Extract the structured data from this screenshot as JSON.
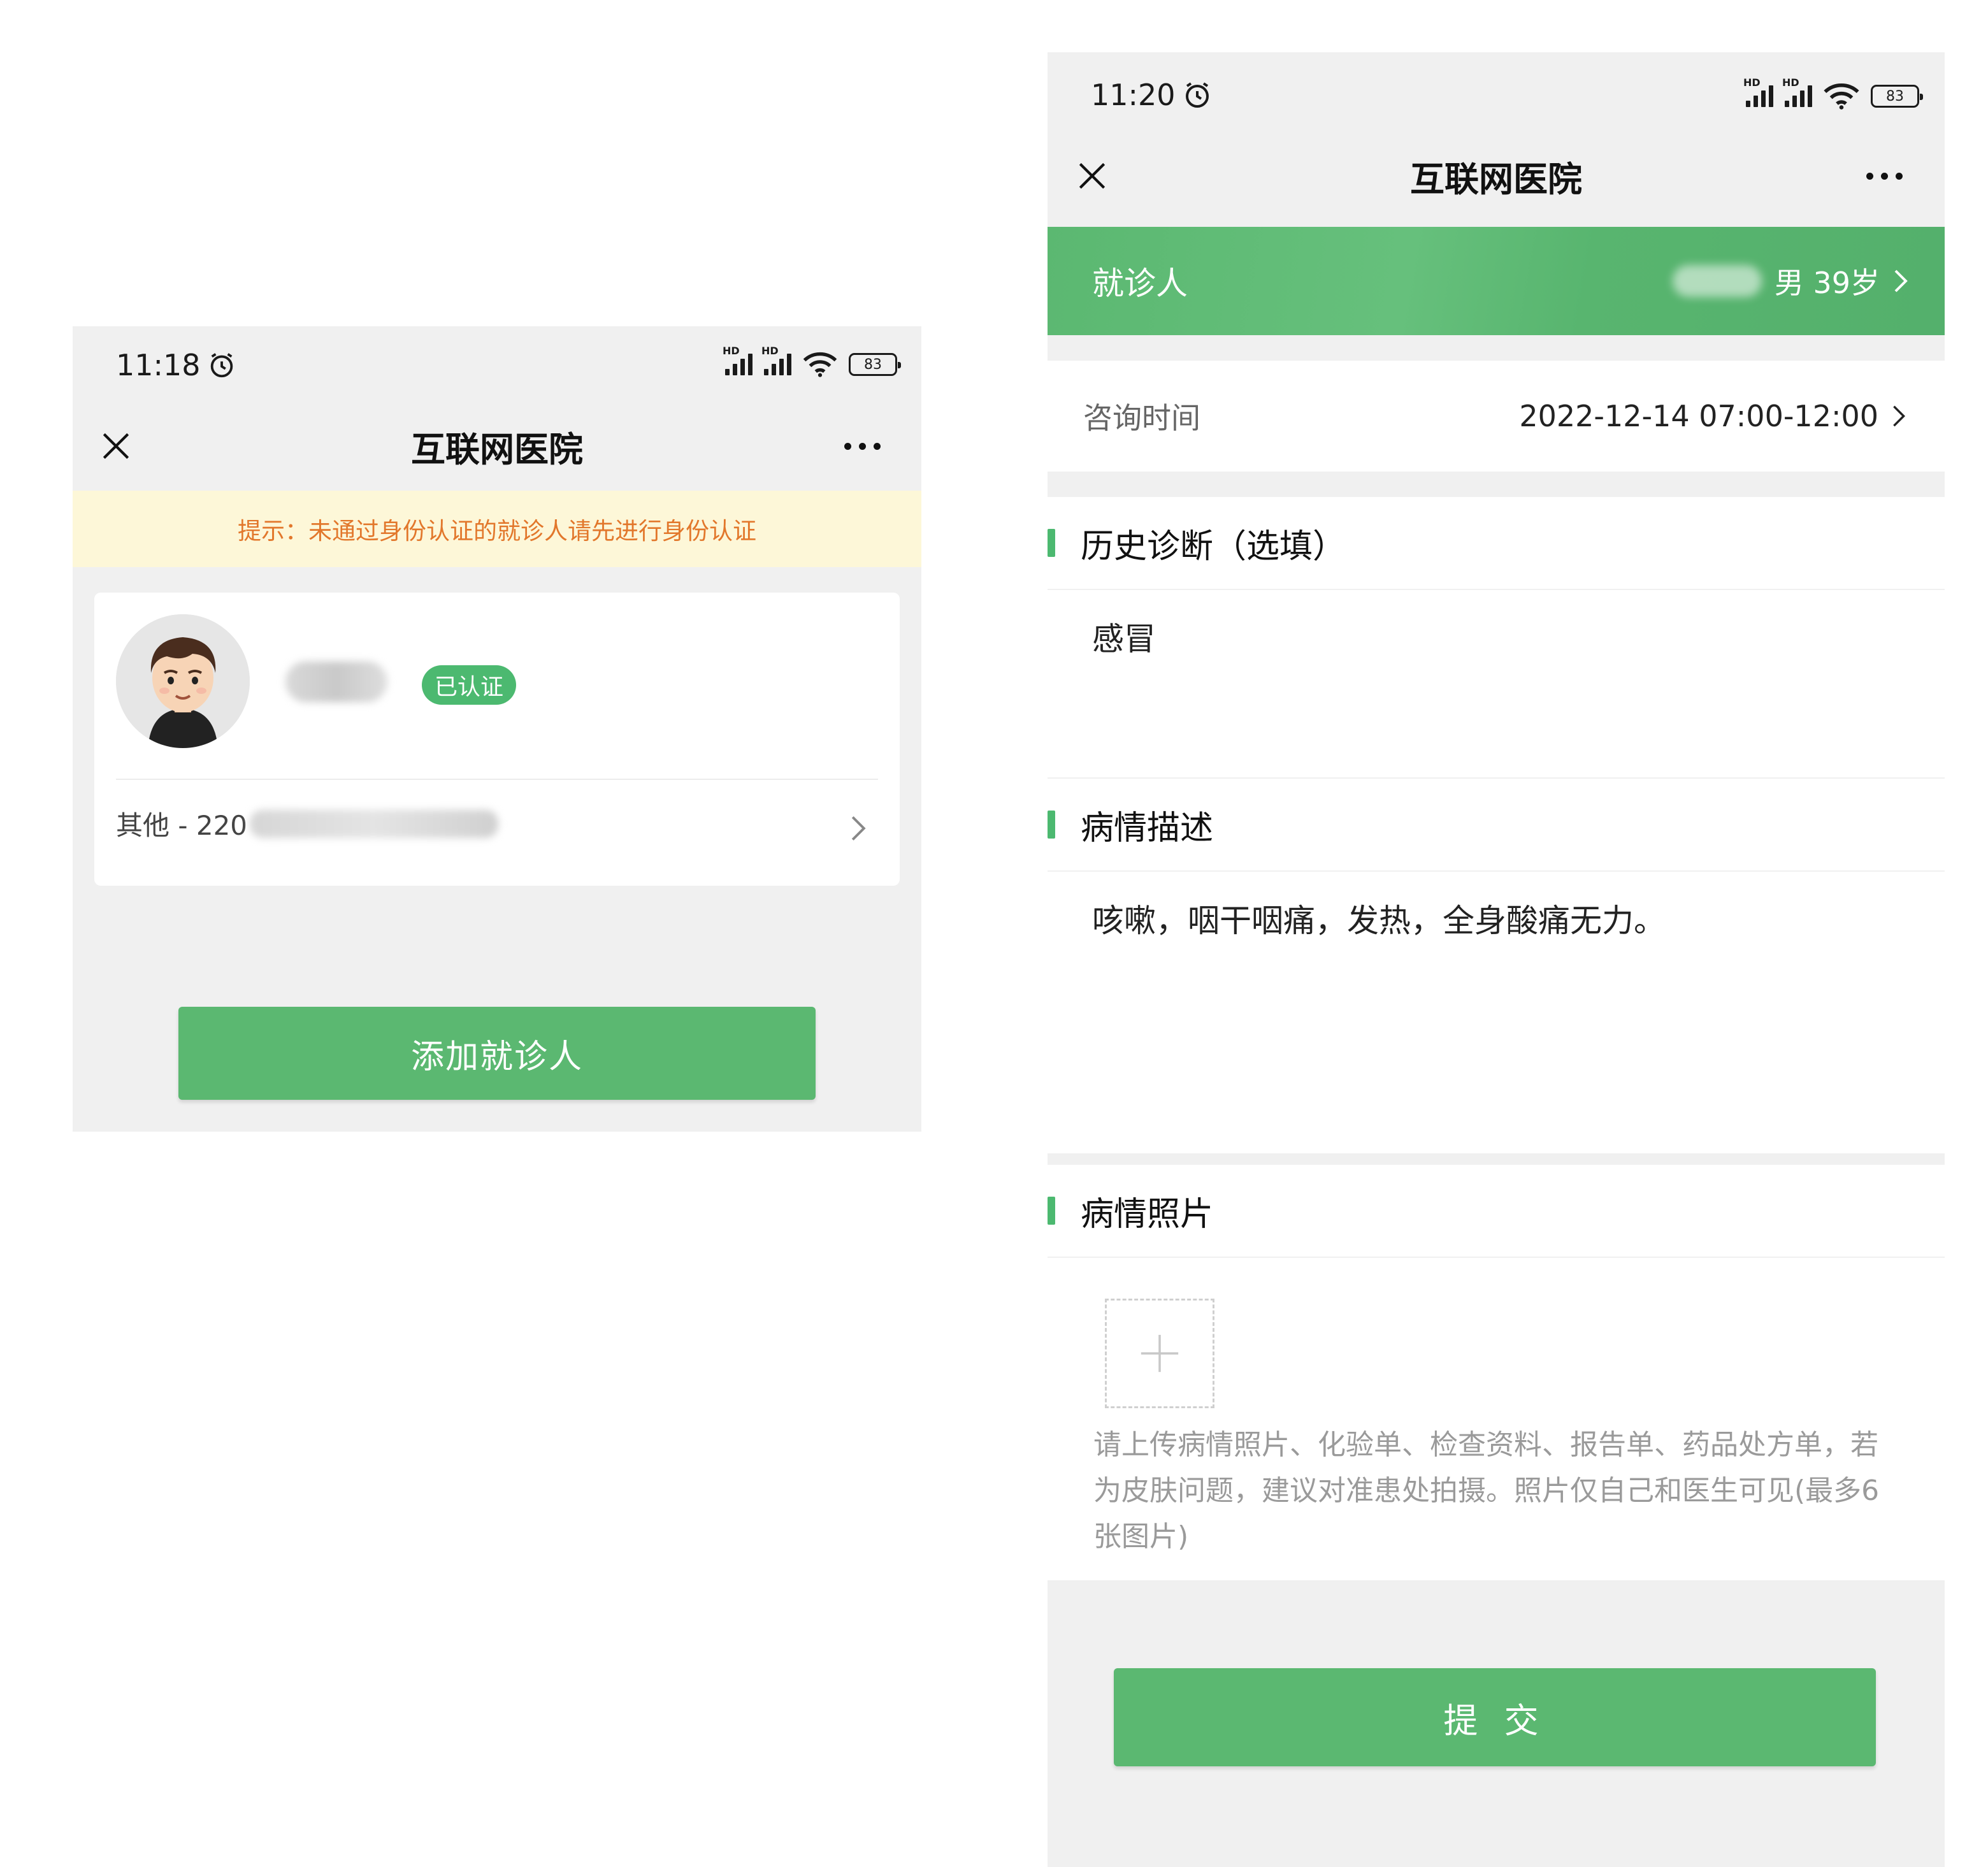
{
  "left_screen": {
    "status": {
      "time": "11:18",
      "battery": "83"
    },
    "nav": {
      "title": "互联网医院"
    },
    "notice": "提示：未通过身份认证的就诊人请先进行身份认证",
    "patient_card": {
      "verified_badge": "已认证",
      "id_line": "其他 - 220"
    },
    "add_button": "添加就诊人"
  },
  "right_screen": {
    "status": {
      "time": "11:20",
      "battery": "83"
    },
    "nav": {
      "title": "互联网医院"
    },
    "patient_bar": {
      "label": "就诊人",
      "info": "男 39岁"
    },
    "consult_time": {
      "label": "咨询时间",
      "value": "2022-12-14 07:00-12:00"
    },
    "history": {
      "title": "历史诊断（选填）",
      "value": "感冒"
    },
    "description": {
      "title": "病情描述",
      "value": "咳嗽，咽干咽痛，发热，全身酸痛无力。"
    },
    "photos": {
      "title": "病情照片",
      "hint": "请上传病情照片、化验单、检查资料、报告单、药品处方单，若为皮肤问题，建议对准患处拍摄。照片仅自己和医生可见(最多6张图片)"
    },
    "submit_button": "提 交"
  },
  "colors": {
    "brand_green": "#5bb871",
    "notice_bg": "#fdf7d8",
    "notice_text": "#e2772b"
  }
}
